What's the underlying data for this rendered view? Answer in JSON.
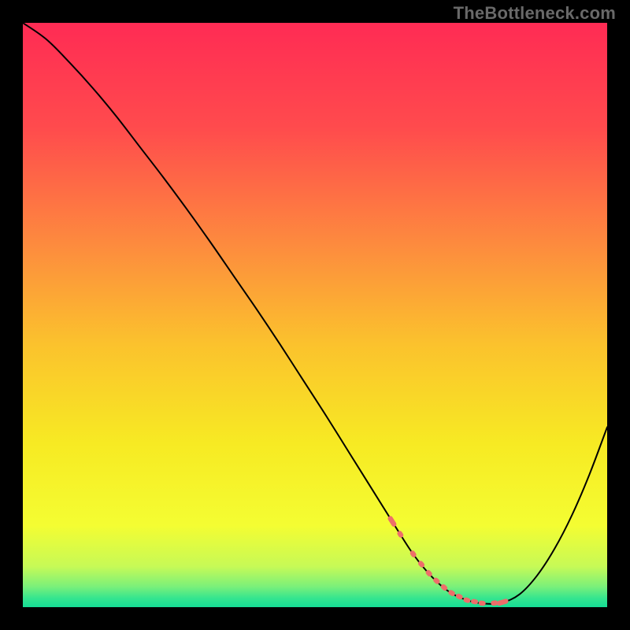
{
  "watermark": "TheBottleneck.com",
  "gradient": {
    "stops": [
      {
        "offset": 0.0,
        "color": "#ff2b54"
      },
      {
        "offset": 0.18,
        "color": "#ff4b4d"
      },
      {
        "offset": 0.38,
        "color": "#fd8b3e"
      },
      {
        "offset": 0.55,
        "color": "#fbc22d"
      },
      {
        "offset": 0.72,
        "color": "#f7ea23"
      },
      {
        "offset": 0.86,
        "color": "#f4fd32"
      },
      {
        "offset": 0.93,
        "color": "#c7fa56"
      },
      {
        "offset": 0.965,
        "color": "#7af07a"
      },
      {
        "offset": 0.985,
        "color": "#34e58f"
      },
      {
        "offset": 1.0,
        "color": "#15dd95"
      }
    ]
  },
  "chart_data": {
    "type": "line",
    "title": "",
    "xlabel": "",
    "ylabel": "",
    "xlim": [
      0,
      100
    ],
    "ylim": [
      0,
      100
    ],
    "x": [
      0,
      4,
      8,
      12,
      16,
      20,
      24,
      28,
      32,
      36,
      40,
      44,
      48,
      52,
      56,
      60,
      64,
      67,
      70,
      73,
      76,
      79,
      82,
      85,
      88,
      91,
      94,
      97,
      100
    ],
    "values": [
      100.0,
      97.2,
      93.2,
      88.8,
      84.0,
      78.8,
      73.6,
      68.2,
      62.6,
      56.8,
      51.0,
      45.0,
      38.8,
      32.6,
      26.2,
      19.8,
      13.4,
      8.8,
      5.2,
      2.6,
      1.2,
      0.6,
      0.8,
      2.2,
      5.4,
      10.0,
      15.8,
      22.8,
      30.8
    ],
    "annotations": {
      "valley_markers_x": [
        63.2,
        64.6,
        66.8,
        68.2,
        69.5,
        70.8,
        72.1,
        73.4,
        74.7,
        76.0,
        77.3,
        78.6,
        80.7,
        82.1
      ]
    }
  }
}
